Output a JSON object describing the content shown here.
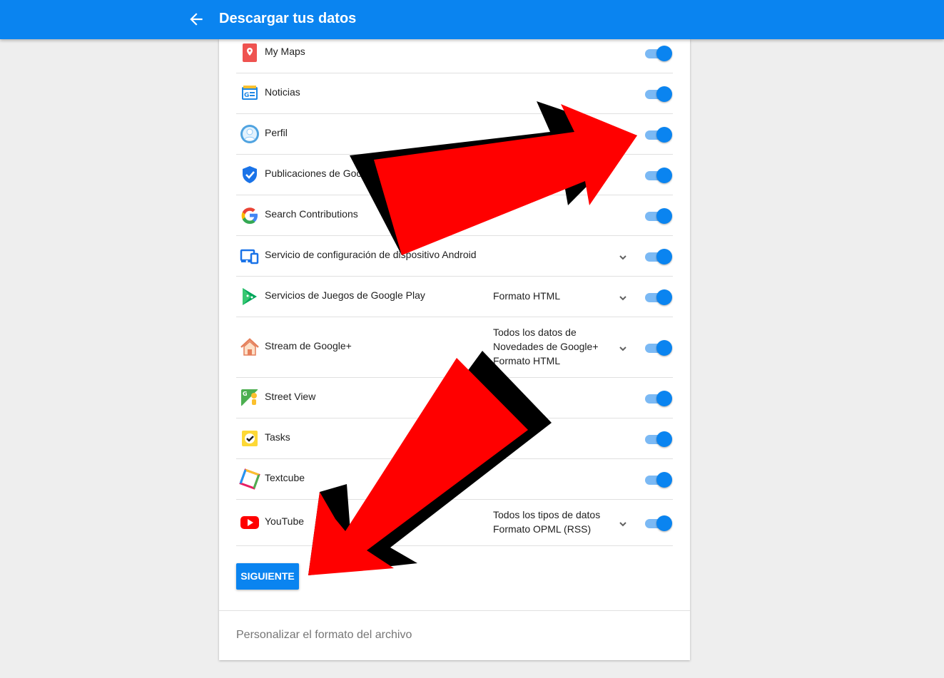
{
  "header": {
    "title": "Descargar tus datos",
    "back_icon": "arrow-back-icon"
  },
  "colors": {
    "accent": "#0a84f0",
    "arrow_red": "#ff0000",
    "arrow_shadow": "#000000"
  },
  "services": [
    {
      "label": "My Maps",
      "icon": "my-maps-icon",
      "format": "",
      "has_dropdown": false,
      "enabled": true
    },
    {
      "label": "Noticias",
      "icon": "news-icon",
      "format": "",
      "has_dropdown": false,
      "enabled": true
    },
    {
      "label": "Perfil",
      "icon": "profile-icon",
      "format": "",
      "has_dropdown": false,
      "enabled": true
    },
    {
      "label": "Publicaciones de Google",
      "icon": "shield-check-icon",
      "format": "",
      "has_dropdown": false,
      "enabled": true
    },
    {
      "label": "Search Contributions",
      "icon": "google-g-icon",
      "format": "",
      "has_dropdown": false,
      "enabled": true
    },
    {
      "label": "Servicio de configuración de dispositivo Android",
      "icon": "devices-icon",
      "format": "",
      "has_dropdown": true,
      "enabled": true
    },
    {
      "label": "Servicios de Juegos de Google Play",
      "icon": "play-games-icon",
      "format": "Formato HTML",
      "has_dropdown": true,
      "enabled": true
    },
    {
      "label": "Stream de Google+",
      "icon": "home-icon",
      "format": "Todos los datos de\nNovedades de Google+\nFormato HTML",
      "has_dropdown": true,
      "enabled": true
    },
    {
      "label": "Street View",
      "icon": "street-view-icon",
      "format": "",
      "has_dropdown": false,
      "enabled": true
    },
    {
      "label": "Tasks",
      "icon": "tasks-icon",
      "format": "",
      "has_dropdown": false,
      "enabled": true
    },
    {
      "label": "Textcube",
      "icon": "textcube-icon",
      "format": "",
      "has_dropdown": false,
      "enabled": true
    },
    {
      "label": "YouTube",
      "icon": "youtube-icon",
      "format": "Todos los tipos de datos\nFormato OPML (RSS)",
      "has_dropdown": true,
      "enabled": true
    }
  ],
  "actions": {
    "next_label": "SIGUIENTE"
  },
  "footer": {
    "customize_label": "Personalizar el formato del archivo"
  }
}
